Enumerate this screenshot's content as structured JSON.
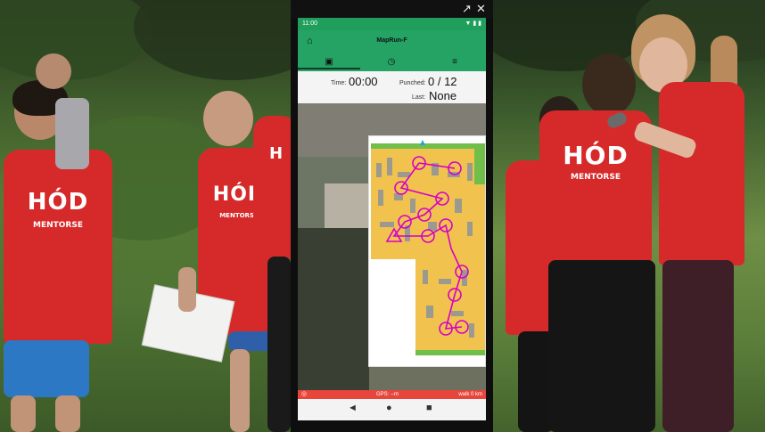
{
  "window": {
    "popout_icon": "popout-icon",
    "close_icon": "close-icon"
  },
  "status_bar": {
    "left_text": "11:00",
    "right_text": "▼ ▮ ▮"
  },
  "app": {
    "title": "MapRun-F",
    "home_icon": "home-icon",
    "tabs": [
      {
        "icon": "map-icon",
        "glyph": "▣",
        "active": true
      },
      {
        "icon": "clock-icon",
        "glyph": "◷",
        "active": false
      },
      {
        "icon": "menu-icon",
        "glyph": "≡",
        "active": false
      }
    ]
  },
  "info": {
    "time_label": "Time:",
    "time_value": "00:00",
    "punched_label": "Punched:",
    "punched_value": "0 / 12",
    "last_label": "Last:",
    "last_value": "None"
  },
  "status_footer": {
    "gps_text": "GPS: --m",
    "walk_text": "walk 0 km"
  },
  "nav": {
    "back_glyph": "◄",
    "home_glyph": "●",
    "recents_glyph": "■"
  },
  "shirts": {
    "brand": "HÓD",
    "sub": "MENTORSE"
  },
  "colors": {
    "accent": "#24a365",
    "gps_bar": "#e8453c",
    "course": "#d400c8",
    "shirt": "#d62a2a"
  }
}
